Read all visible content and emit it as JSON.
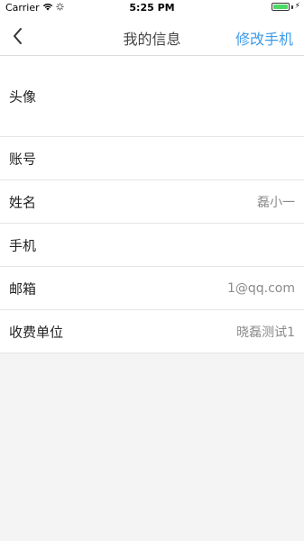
{
  "status_bar": {
    "carrier": "Carrier",
    "time": "5:25 PM",
    "battery_level": 1.0,
    "icons": [
      "wifi-icon",
      "loading-icon",
      "battery-icon",
      "charging-icon"
    ]
  },
  "nav": {
    "back_icon": "chevron-left-icon",
    "title": "我的信息",
    "action_label": "修改手机",
    "action_color": "#3d9be9"
  },
  "rows": [
    {
      "label": "头像",
      "value": ""
    },
    {
      "label": "账号",
      "value": ""
    },
    {
      "label": "姓名",
      "value": "磊小一"
    },
    {
      "label": "手机",
      "value": ""
    },
    {
      "label": "邮箱",
      "value": "1@qq.com"
    },
    {
      "label": "收费单位",
      "value": "晓磊测试1"
    }
  ]
}
